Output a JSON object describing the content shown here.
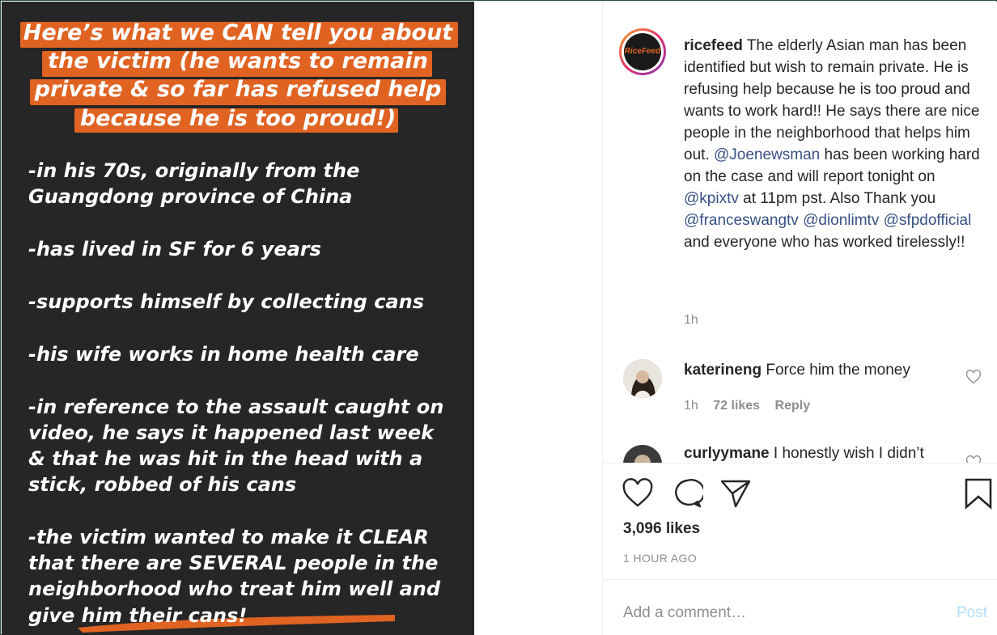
{
  "story": {
    "heading_lines": [
      "Here’s what we CAN tell you about",
      "the victim (he wants to remain",
      "private & so far has refused help",
      "because he is too proud!)"
    ],
    "bullet_lines": [
      "-in his 70s, originally from the",
      "Guangdong province of China",
      "-has lived in SF for 6 years",
      "-supports himself by collecting cans",
      "-his wife works in home health care",
      "-in reference to the assault caught on",
      "video, he says it happened last week",
      "& that he was hit in the head with a",
      "stick, robbed of his cans",
      "-the victim wanted to make it CLEAR",
      "that there are SEVERAL people in the",
      "neighborhood who treat him well and",
      "give him their cans!"
    ],
    "highlight_color": "#e06322"
  },
  "post": {
    "avatar_label": "RiceFeed",
    "username": "ricefeed",
    "caption_parts": [
      " The elderly Asian man has been identified but wish to remain private. He is refusing help because he is too proud and wants to work hard!! He says there are nice people in the neighborhood that helps him out. ",
      "@Joenewsman",
      " has been working hard on the case and will report tonight on ",
      "@kpixtv",
      " at 11pm pst. Also Thank you ",
      "@franceswangtv",
      " ",
      "@dionlimtv",
      " ",
      "@sfpdofficial",
      " and everyone who has worked tirelessly!!"
    ],
    "timestamp": "1h",
    "mention_color": "#385185"
  },
  "comments": [
    {
      "username": "katerineng",
      "text": "Force him the money",
      "time": "1h",
      "likes": "72 likes",
      "reply": "Reply"
    },
    {
      "username": "curlyymane",
      "text": "I honestly wish I didn’t"
    }
  ],
  "actions": {
    "like_icon": "heart-icon",
    "comment_icon": "comment-icon",
    "share_icon": "paper-plane-icon",
    "save_icon": "bookmark-icon"
  },
  "likes_count": "3,096 likes",
  "time_ago": "1 HOUR AGO",
  "add_comment_placeholder": "Add a comment…",
  "post_button": "Post"
}
